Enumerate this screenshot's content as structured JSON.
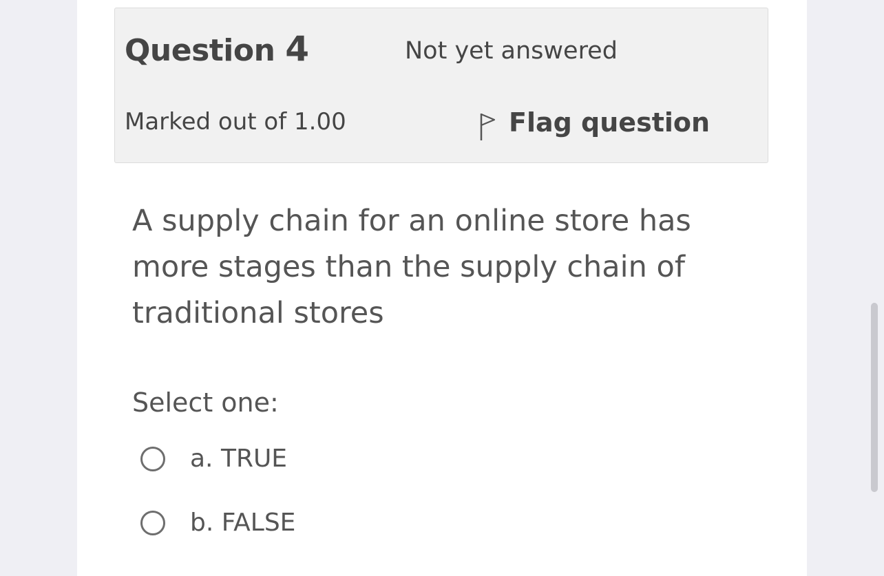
{
  "question": {
    "title_word": "Question",
    "number": "4",
    "state": "Not yet answered",
    "grade": "Marked out of 1.00",
    "flag_label": "Flag question",
    "flag_icon": "flag-icon",
    "text": "A supply chain for an online store has more stages than the supply chain of traditional stores"
  },
  "answer": {
    "prompt": "Select one:",
    "options": [
      {
        "label": "a. TRUE",
        "selected": false
      },
      {
        "label": "b. FALSE",
        "selected": false
      }
    ]
  },
  "colors": {
    "page_background": "#efeff4",
    "content_background": "#ffffff",
    "info_box_background": "#f1f1f1",
    "text": "#555555",
    "heading_text": "#454545"
  }
}
